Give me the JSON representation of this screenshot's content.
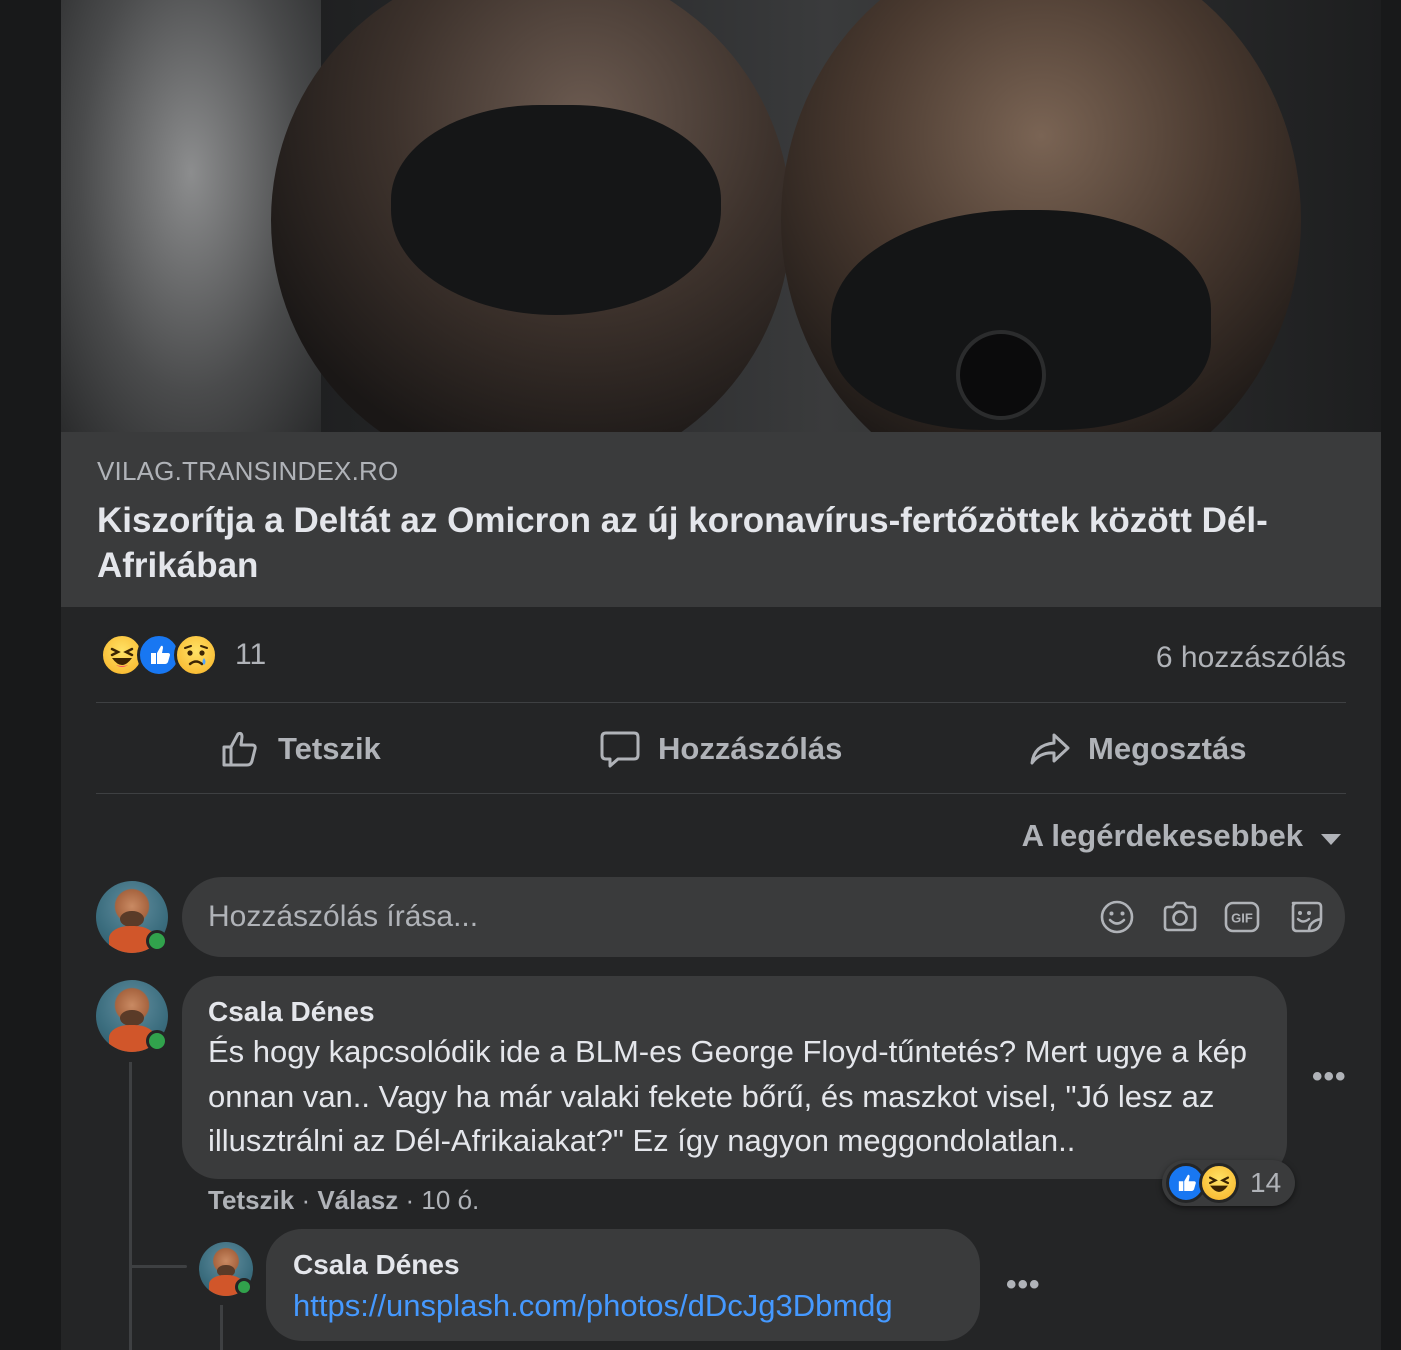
{
  "link_preview": {
    "domain": "VILAG.TRANSINDEX.RO",
    "title": "Kiszorítja a Deltát az Omicron az új koronavírus-fertőzöttek között Dél-Afrikában"
  },
  "stats": {
    "reaction_types": [
      "haha",
      "like",
      "sad"
    ],
    "reaction_count": "11",
    "comment_count": "6 hozzászólás"
  },
  "actions": {
    "like": "Tetszik",
    "comment": "Hozzászólás",
    "share": "Megosztás"
  },
  "sort": {
    "label": "A legérdekesebbek"
  },
  "composer": {
    "placeholder": "Hozzászólás írása..."
  },
  "comments": [
    {
      "author": "Csala Dénes",
      "text": "És hogy kapcsolódik ide a BLM-es George Floyd-tűntetés? Mert ugye a kép onnan van.. Vagy ha már valaki fekete bőrű, és maszkot visel, \"Jó lesz az illusztrálni az Dél-Afrikaiakat?\" Ez így nagyon meggondolatlan..",
      "like_label": "Tetszik",
      "reply_label": "Válasz",
      "time": "10 ó.",
      "reaction_types": [
        "like",
        "haha"
      ],
      "reaction_count": "14",
      "more": "•••"
    },
    {
      "author": "Csala Dénes",
      "link": "https://unsplash.com/photos/dDcJg3Dbmdg",
      "more": "•••"
    }
  ],
  "colors": {
    "background": "#18191a",
    "card": "#242526",
    "surface": "#3a3b3c",
    "text_primary": "#e4e6eb",
    "text_secondary": "#b0b3b8",
    "link": "#4599ff",
    "like_blue": "#1877f2",
    "online_green": "#31a24c"
  }
}
